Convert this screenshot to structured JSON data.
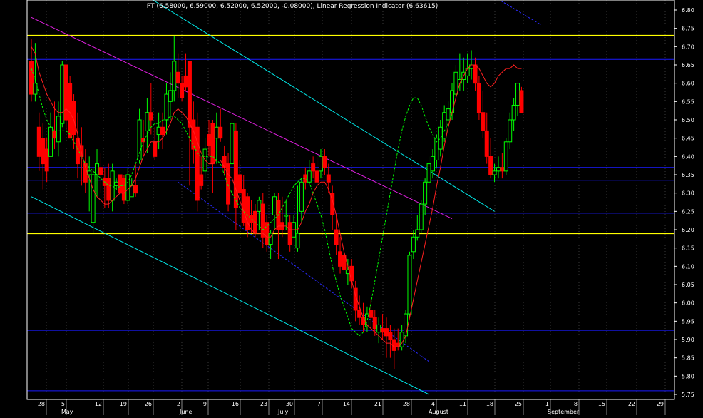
{
  "chart_data": {
    "type": "candlestick",
    "title": "PT (6.58000, 6.59000, 6.52000, 6.52000, -0.08000), Linear Regression Indicator (6.63615)",
    "ylim": [
      5.75,
      6.8
    ],
    "y_ticks": [
      "5.75",
      "5.80",
      "5.85",
      "5.90",
      "5.95",
      "6.00",
      "6.05",
      "6.10",
      "6.15",
      "6.20",
      "6.25",
      "6.30",
      "6.35",
      "6.40",
      "6.45",
      "6.50",
      "6.55",
      "6.60",
      "6.65",
      "6.70",
      "6.75",
      "6.80"
    ],
    "x_day_ticks": [
      "28",
      "5",
      "12",
      "19",
      "26",
      "2",
      "9",
      "16",
      "23",
      "30",
      "7",
      "14",
      "21",
      "28",
      "4",
      "11",
      "18",
      "25",
      "1",
      "8",
      "15",
      "22",
      "29"
    ],
    "x_month_labels": [
      "May",
      "June",
      "July",
      "August",
      "September"
    ],
    "trading_days": 156,
    "up_color": "#00ff00",
    "down_color": "#ff0000",
    "doji_color": "#00ff00",
    "horizontal_levels": [
      {
        "value": 6.73,
        "color": "#ffff00"
      },
      {
        "value": 6.19,
        "color": "#ffff00"
      },
      {
        "value": 6.665,
        "color": "#1a1aff"
      },
      {
        "value": 6.37,
        "color": "#1a1aff"
      },
      {
        "value": 6.335,
        "color": "#1a1aff"
      },
      {
        "value": 6.245,
        "color": "#1a1aff"
      },
      {
        "value": 5.925,
        "color": "#1a1aff"
      },
      {
        "value": 5.76,
        "color": "#1a1aff"
      }
    ],
    "trend_lines": [
      {
        "color": "#00e5e5",
        "from": [
          28,
          6.85
        ],
        "to": [
          120,
          6.25
        ]
      },
      {
        "color": "#00e5e5",
        "from": [
          0,
          6.29
        ],
        "to": [
          103,
          5.75
        ]
      },
      {
        "color": "#e020e0",
        "from": [
          0,
          6.78
        ],
        "to": [
          109,
          6.23
        ]
      },
      {
        "color": "#2a2aff",
        "dashed": true,
        "from": [
          38,
          6.33
        ],
        "to": [
          103,
          5.84
        ]
      },
      {
        "color": "#2a2aff",
        "dashed": true,
        "from": [
          105,
          6.93
        ],
        "to": [
          132,
          6.76
        ]
      }
    ],
    "candles": [
      [
        6.66,
        6.72,
        6.55,
        6.57
      ],
      [
        6.57,
        6.71,
        6.55,
        6.6
      ],
      [
        6.48,
        6.52,
        6.36,
        6.4
      ],
      [
        6.45,
        6.49,
        6.31,
        6.38
      ],
      [
        6.42,
        6.45,
        6.33,
        6.36
      ],
      [
        6.4,
        6.52,
        6.4,
        6.48
      ],
      [
        6.47,
        6.55,
        6.42,
        6.45
      ],
      [
        6.44,
        6.55,
        6.4,
        6.51
      ],
      [
        6.49,
        6.66,
        6.48,
        6.65
      ],
      [
        6.65,
        6.65,
        6.47,
        6.5
      ],
      [
        6.6,
        6.62,
        6.45,
        6.45
      ],
      [
        6.55,
        6.57,
        6.42,
        6.46
      ],
      [
        6.45,
        6.52,
        6.34,
        6.38
      ],
      [
        6.43,
        6.48,
        6.32,
        6.4
      ],
      [
        6.38,
        6.42,
        6.3,
        6.33
      ],
      [
        6.35,
        6.4,
        6.25,
        6.36
      ],
      [
        6.22,
        6.37,
        6.19,
        6.35
      ],
      [
        6.35,
        6.42,
        6.29,
        6.38
      ],
      [
        6.37,
        6.41,
        6.3,
        6.35
      ],
      [
        6.34,
        6.37,
        6.26,
        6.32
      ],
      [
        6.34,
        6.38,
        6.26,
        6.28
      ],
      [
        6.28,
        6.38,
        6.25,
        6.36
      ],
      [
        6.32,
        6.34,
        6.31,
        6.33
      ],
      [
        6.35,
        6.37,
        6.27,
        6.3
      ],
      [
        6.34,
        6.35,
        6.27,
        6.28
      ],
      [
        6.28,
        6.37,
        6.27,
        6.35
      ],
      [
        6.29,
        6.34,
        6.29,
        6.32
      ],
      [
        6.32,
        6.38,
        6.29,
        6.3
      ],
      [
        6.39,
        6.53,
        6.38,
        6.5
      ],
      [
        6.45,
        6.5,
        6.4,
        6.44
      ],
      [
        6.47,
        6.56,
        6.41,
        6.52
      ],
      [
        6.52,
        6.6,
        6.46,
        6.5
      ],
      [
        6.44,
        6.48,
        6.39,
        6.4
      ],
      [
        6.46,
        6.52,
        6.42,
        6.48
      ],
      [
        6.48,
        6.52,
        6.42,
        6.46
      ],
      [
        6.5,
        6.6,
        6.46,
        6.57
      ],
      [
        6.55,
        6.63,
        6.5,
        6.58
      ],
      [
        6.58,
        6.73,
        6.55,
        6.66
      ],
      [
        6.63,
        6.68,
        6.56,
        6.6
      ],
      [
        6.6,
        6.62,
        6.55,
        6.56
      ],
      [
        6.62,
        6.68,
        6.58,
        6.59
      ],
      [
        6.66,
        6.66,
        6.32,
        6.48
      ],
      [
        6.5,
        6.55,
        6.38,
        6.42
      ],
      [
        6.48,
        6.52,
        6.25,
        6.28
      ],
      [
        6.35,
        6.4,
        6.31,
        6.32
      ],
      [
        6.36,
        6.45,
        6.34,
        6.42
      ],
      [
        6.46,
        6.5,
        6.4,
        6.43
      ],
      [
        6.49,
        6.5,
        6.3,
        6.38
      ],
      [
        6.45,
        6.52,
        6.38,
        6.48
      ],
      [
        6.48,
        6.53,
        6.44,
        6.45
      ],
      [
        6.4,
        6.43,
        6.35,
        6.37
      ],
      [
        6.38,
        6.41,
        6.25,
        6.27
      ],
      [
        6.38,
        6.5,
        6.35,
        6.49
      ],
      [
        6.47,
        6.49,
        6.2,
        6.26
      ],
      [
        6.35,
        6.39,
        6.28,
        6.3
      ],
      [
        6.31,
        6.35,
        6.21,
        6.22
      ],
      [
        6.29,
        6.3,
        6.18,
        6.2
      ],
      [
        6.24,
        6.28,
        6.19,
        6.22
      ],
      [
        6.25,
        6.27,
        6.18,
        6.19
      ],
      [
        6.25,
        6.29,
        6.2,
        6.28
      ],
      [
        6.27,
        6.3,
        6.15,
        6.18
      ],
      [
        6.22,
        6.24,
        6.14,
        6.16
      ],
      [
        6.16,
        6.2,
        6.12,
        6.19
      ],
      [
        6.24,
        6.3,
        6.2,
        6.29
      ],
      [
        6.28,
        6.3,
        6.12,
        6.2
      ],
      [
        6.22,
        6.29,
        6.18,
        6.2
      ],
      [
        6.24,
        6.28,
        6.2,
        6.24
      ],
      [
        6.22,
        6.24,
        6.14,
        6.16
      ],
      [
        6.18,
        6.24,
        6.18,
        6.22
      ],
      [
        6.15,
        6.32,
        6.14,
        6.19
      ],
      [
        6.25,
        6.34,
        6.22,
        6.33
      ],
      [
        6.35,
        6.37,
        6.31,
        6.33
      ],
      [
        6.33,
        6.39,
        6.32,
        6.36
      ],
      [
        6.38,
        6.4,
        6.34,
        6.36
      ],
      [
        6.36,
        6.4,
        6.32,
        6.33
      ],
      [
        6.36,
        6.42,
        6.34,
        6.4
      ],
      [
        6.4,
        6.42,
        6.35,
        6.37
      ],
      [
        6.35,
        6.38,
        6.3,
        6.33
      ],
      [
        6.3,
        6.32,
        6.2,
        6.24
      ],
      [
        6.2,
        6.24,
        6.13,
        6.16
      ],
      [
        6.14,
        6.18,
        6.08,
        6.1
      ],
      [
        6.13,
        6.16,
        6.08,
        6.09
      ],
      [
        6.08,
        6.12,
        6.05,
        6.09
      ],
      [
        6.1,
        6.12,
        6.04,
        6.06
      ],
      [
        6.04,
        6.06,
        5.95,
        5.98
      ],
      [
        5.98,
        6.02,
        5.94,
        5.96
      ],
      [
        5.96,
        6.0,
        5.92,
        5.94
      ],
      [
        5.94,
        5.99,
        5.92,
        5.97
      ],
      [
        5.98,
        6.01,
        5.93,
        5.96
      ],
      [
        5.96,
        5.98,
        5.91,
        5.93
      ],
      [
        5.92,
        5.96,
        5.89,
        5.94
      ],
      [
        5.93,
        5.97,
        5.9,
        5.92
      ],
      [
        5.93,
        5.96,
        5.85,
        5.91
      ],
      [
        5.92,
        5.94,
        5.85,
        5.9
      ],
      [
        5.9,
        5.93,
        5.82,
        5.87
      ],
      [
        5.89,
        5.93,
        5.87,
        5.88
      ],
      [
        5.88,
        5.94,
        5.87,
        5.92
      ],
      [
        5.91,
        5.98,
        5.89,
        5.97
      ],
      [
        5.97,
        6.14,
        5.96,
        6.13
      ],
      [
        6.14,
        6.2,
        6.12,
        6.18
      ],
      [
        6.18,
        6.24,
        6.17,
        6.2
      ],
      [
        6.2,
        6.28,
        6.19,
        6.27
      ],
      [
        6.27,
        6.34,
        6.24,
        6.33
      ],
      [
        6.33,
        6.4,
        6.3,
        6.38
      ],
      [
        6.36,
        6.42,
        6.34,
        6.4
      ],
      [
        6.39,
        6.46,
        6.37,
        6.45
      ],
      [
        6.42,
        6.5,
        6.4,
        6.48
      ],
      [
        6.45,
        6.54,
        6.44,
        6.52
      ],
      [
        6.5,
        6.55,
        6.48,
        6.53
      ],
      [
        6.52,
        6.6,
        6.5,
        6.58
      ],
      [
        6.57,
        6.65,
        6.55,
        6.63
      ],
      [
        6.6,
        6.68,
        6.58,
        6.61
      ],
      [
        6.61,
        6.67,
        6.58,
        6.63
      ],
      [
        6.62,
        6.68,
        6.6,
        6.64
      ],
      [
        6.64,
        6.69,
        6.61,
        6.65
      ],
      [
        6.65,
        6.67,
        6.58,
        6.6
      ],
      [
        6.6,
        6.62,
        6.5,
        6.52
      ],
      [
        6.52,
        6.58,
        6.45,
        6.47
      ],
      [
        6.47,
        6.52,
        6.38,
        6.4
      ],
      [
        6.4,
        6.45,
        6.34,
        6.35
      ],
      [
        6.35,
        6.38,
        6.33,
        6.36
      ],
      [
        6.36,
        6.4,
        6.34,
        6.37
      ],
      [
        6.37,
        6.41,
        6.34,
        6.36
      ],
      [
        6.36,
        6.45,
        6.35,
        6.44
      ],
      [
        6.44,
        6.52,
        6.42,
        6.5
      ],
      [
        6.5,
        6.56,
        6.47,
        6.54
      ],
      [
        6.54,
        6.6,
        6.51,
        6.6
      ],
      [
        6.58,
        6.59,
        6.52,
        6.52
      ]
    ],
    "linear_regression_indicator": {
      "name": "Linear Regression Indicator",
      "color": "#ff2020",
      "values": [
        6.7,
        6.68,
        6.63,
        6.6,
        6.57,
        6.55,
        6.53,
        6.52,
        6.52,
        6.53,
        6.52,
        6.5,
        6.46,
        6.41,
        6.37,
        6.34,
        6.31,
        6.29,
        6.28,
        6.27,
        6.27,
        6.28,
        6.29,
        6.3,
        6.3,
        6.31,
        6.32,
        6.34,
        6.37,
        6.4,
        6.42,
        6.44,
        6.44,
        6.44,
        6.45,
        6.47,
        6.49,
        6.52,
        6.53,
        6.52,
        6.51,
        6.49,
        6.47,
        6.44,
        6.41,
        6.39,
        6.38,
        6.38,
        6.39,
        6.39,
        6.37,
        6.35,
        6.34,
        6.31,
        6.28,
        6.25,
        6.22,
        6.2,
        6.19,
        6.19,
        6.19,
        6.18,
        6.18,
        6.2,
        6.21,
        6.21,
        6.21,
        6.2,
        6.2,
        6.2,
        6.22,
        6.25,
        6.27,
        6.3,
        6.32,
        6.33,
        6.33,
        6.31,
        6.28,
        6.24,
        6.19,
        6.14,
        6.1,
        6.06,
        6.02,
        5.99,
        5.96,
        5.94,
        5.93,
        5.92,
        5.91,
        5.9,
        5.89,
        5.89,
        5.88,
        5.88,
        5.89,
        5.91,
        5.96,
        6.01,
        6.06,
        6.11,
        6.16,
        6.21,
        6.26,
        6.32,
        6.37,
        6.43,
        6.48,
        6.52,
        6.56,
        6.6,
        6.62,
        6.64,
        6.65,
        6.65,
        6.64,
        6.62,
        6.6,
        6.59,
        6.6,
        6.62,
        6.63,
        6.64,
        6.64,
        6.65,
        6.64,
        6.64
      ]
    },
    "moving_average": {
      "color": "#00ff00",
      "dashed": true,
      "values": [
        6.64,
        6.61,
        6.57,
        6.53,
        6.5,
        6.48,
        6.47,
        6.47,
        6.47,
        6.47,
        6.46,
        6.44,
        6.42,
        6.4,
        6.38,
        6.37,
        6.36,
        6.35,
        6.34,
        6.33,
        6.32,
        6.32,
        6.31,
        6.32,
        6.32,
        6.33,
        6.35,
        6.38,
        6.41,
        6.44,
        6.46,
        6.48,
        6.49,
        6.49,
        6.5,
        6.5,
        6.51,
        6.51,
        6.5,
        6.49,
        6.47,
        6.45,
        6.43,
        6.41,
        6.4,
        6.4,
        6.4,
        6.4,
        6.39,
        6.38,
        6.35,
        6.32,
        6.3,
        6.28,
        6.26,
        6.25,
        6.24,
        6.23,
        6.22,
        6.21,
        6.2,
        6.21,
        6.22,
        6.23,
        6.24,
        6.26,
        6.28,
        6.3,
        6.32,
        6.33,
        6.34,
        6.34,
        6.33,
        6.3,
        6.27,
        6.24,
        6.2,
        6.15,
        6.1,
        6.06,
        6.02,
        5.99,
        5.96,
        5.93,
        5.92,
        5.91,
        5.92,
        5.95,
        6.0,
        6.06,
        6.12,
        6.18,
        6.24,
        6.3,
        6.36,
        6.42,
        6.47,
        6.51,
        6.54,
        6.56,
        6.56,
        6.54,
        6.51,
        6.48,
        6.46,
        6.44,
        6.45,
        6.47,
        6.49
      ]
    }
  }
}
